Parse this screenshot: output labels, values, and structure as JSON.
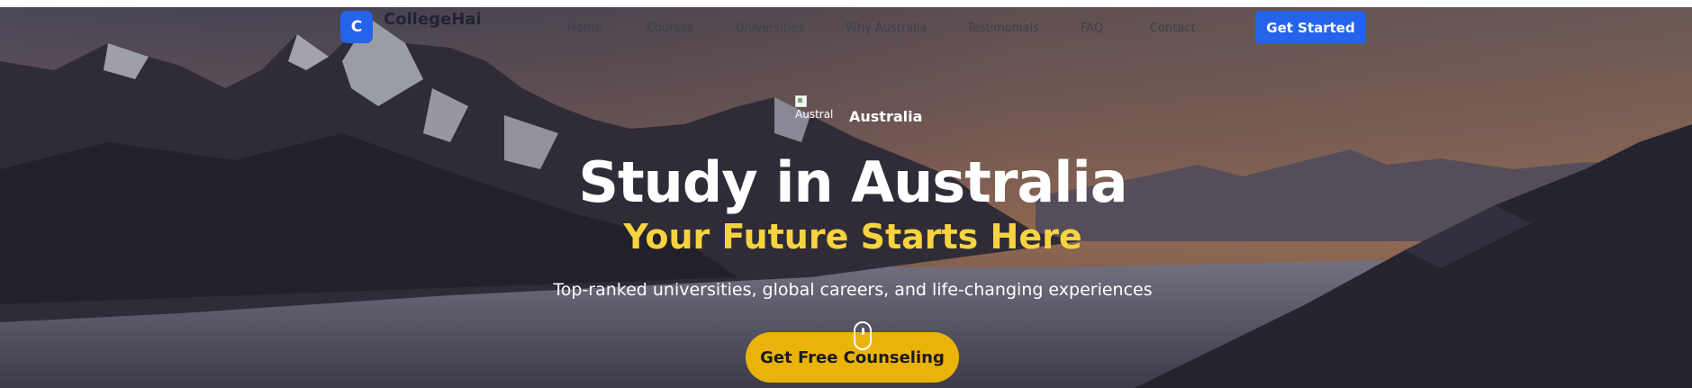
{
  "header": {
    "logo_letter": "C",
    "brand": "CollegeHai",
    "nav": [
      "Home",
      "Courses",
      "Universities",
      "Why Australia",
      "Testimonials",
      "FAQ",
      "Contact"
    ],
    "cta_label": "Get Started"
  },
  "hero": {
    "flag_alt": "Austral",
    "country": "Australia",
    "title": "Study in Australia",
    "subtitle": "Your Future Starts Here",
    "tagline": "Top-ranked universities, global careers, and life-changing experiences",
    "cta_label": "Get Free Counseling"
  },
  "colors": {
    "primary": "#2563eb",
    "accent_yellow": "#eab308",
    "subtitle_yellow": "#f7d33f"
  }
}
